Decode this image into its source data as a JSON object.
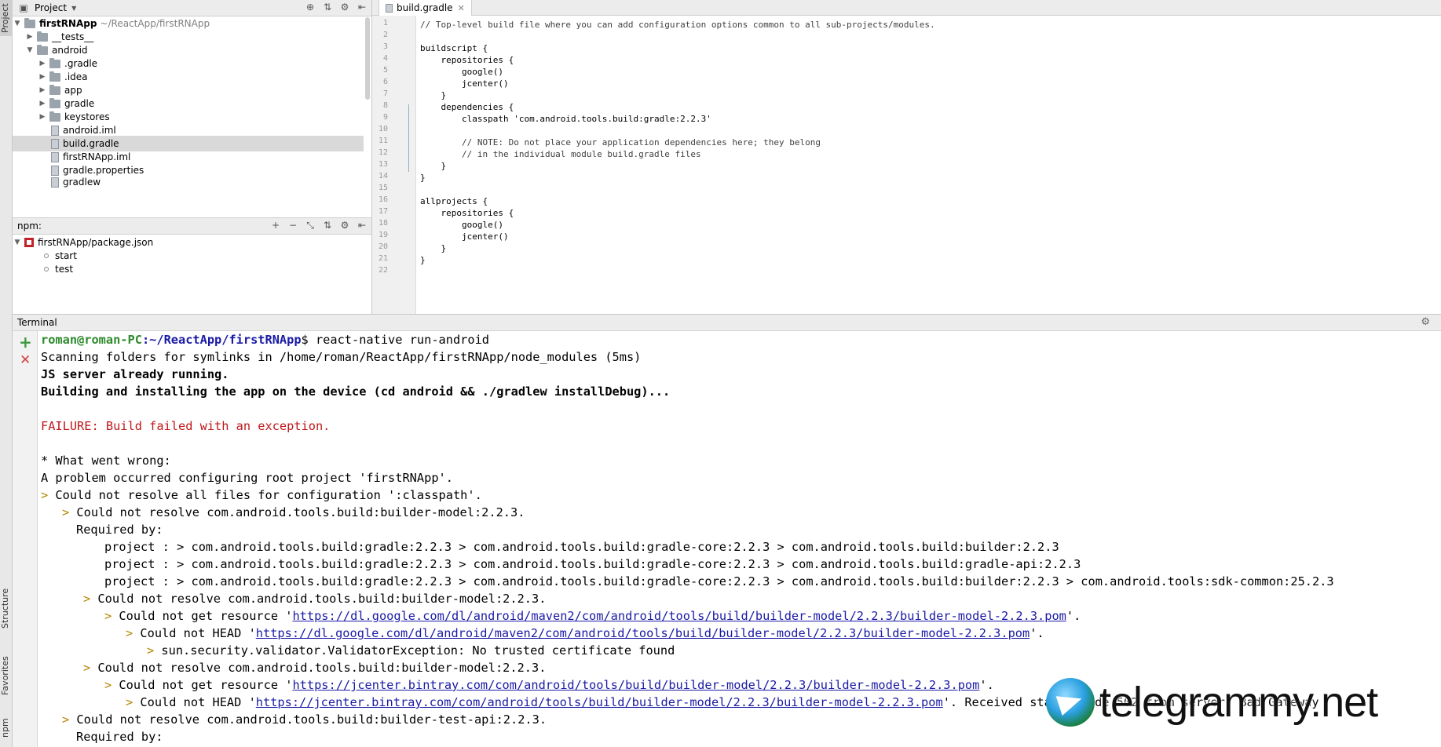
{
  "sidebar": {
    "project_tab": "Project",
    "structure_tab": "Structure",
    "favorites_tab": "Favorites",
    "npm_tab": "npm"
  },
  "project_panel": {
    "title": "Project",
    "tree": [
      {
        "label": "firstRNApp",
        "path": "~/ReactApp/firstRNApp",
        "expanded": true,
        "type": "folder"
      },
      {
        "label": "__tests__",
        "type": "folder"
      },
      {
        "label": "android",
        "type": "folder",
        "expanded": true
      },
      {
        "label": ".gradle",
        "type": "folder"
      },
      {
        "label": ".idea",
        "type": "folder"
      },
      {
        "label": "app",
        "type": "folder"
      },
      {
        "label": "gradle",
        "type": "folder"
      },
      {
        "label": "keystores",
        "type": "folder"
      },
      {
        "label": "android.iml",
        "type": "file"
      },
      {
        "label": "build.gradle",
        "type": "file",
        "selected": true
      },
      {
        "label": "firstRNApp.iml",
        "type": "file"
      },
      {
        "label": "gradle.properties",
        "type": "file"
      },
      {
        "label": "gradlew",
        "type": "file"
      }
    ]
  },
  "npm_panel": {
    "title": "npm:",
    "package": "firstRNApp/package.json",
    "scripts": [
      "start",
      "test"
    ]
  },
  "editor": {
    "tab_label": "build.gradle",
    "lines": [
      "// Top-level build file where you can add configuration options common to all sub-projects/modules.",
      "",
      "buildscript {",
      "    repositories {",
      "        google()",
      "        jcenter()",
      "    }",
      "    dependencies {",
      "        classpath 'com.android.tools.build:gradle:2.2.3'",
      "",
      "        // NOTE: Do not place your application dependencies here; they belong",
      "        // in the individual module build.gradle files",
      "    }",
      "}",
      "",
      "allprojects {",
      "    repositories {",
      "        google()",
      "        jcenter()",
      "    }",
      "}",
      ""
    ]
  },
  "terminal": {
    "title": "Terminal",
    "prompt_user": "roman@roman-PC",
    "prompt_path": ":~/ReactApp/firstRNApp",
    "command": "$ react-native run-android",
    "lines": [
      "Scanning folders for symlinks in /home/roman/ReactApp/firstRNApp/node_modules (5ms)",
      "JS server already running.",
      "Building and installing the app on the device (cd android && ./gradlew installDebug)...",
      "FAILURE: Build failed with an exception.",
      "* What went wrong:",
      "A problem occurred configuring root project 'firstRNApp'.",
      "Could not resolve all files for configuration ':classpath'.",
      "Could not resolve com.android.tools.build:builder-model:2.2.3.",
      "Required by:",
      "project : > com.android.tools.build:gradle:2.2.3 > com.android.tools.build:gradle-core:2.2.3 > com.android.tools.build:builder:2.2.3",
      "project : > com.android.tools.build:gradle:2.2.3 > com.android.tools.build:gradle-core:2.2.3 > com.android.tools.build:gradle-api:2.2.3",
      "project : > com.android.tools.build:gradle:2.2.3 > com.android.tools.build:gradle-core:2.2.3 > com.android.tools.build:builder:2.2.3 > com.android.tools:sdk-common:25.2.3",
      "Could not resolve com.android.tools.build:builder-model:2.2.3.",
      "Could not get resource '",
      "https://dl.google.com/dl/android/maven2/com/android/tools/build/builder-model/2.2.3/builder-model-2.2.3.pom",
      "'.",
      "Could not HEAD '",
      "https://dl.google.com/dl/android/maven2/com/android/tools/build/builder-model/2.2.3/builder-model-2.2.3.pom",
      "'.",
      "sun.security.validator.ValidatorException: No trusted certificate found",
      "Could not resolve com.android.tools.build:builder-model:2.2.3.",
      "Could not get resource '",
      "https://jcenter.bintray.com/com/android/tools/build/builder-model/2.2.3/builder-model-2.2.3.pom",
      "'.",
      "Could not HEAD '",
      "https://jcenter.bintray.com/com/android/tools/build/builder-model/2.2.3/builder-model-2.2.3.pom",
      "'. Received status code 502 from server: Bad Gateway",
      "Could not resolve com.android.tools.build:builder-test-api:2.2.3.",
      "Required by:"
    ]
  },
  "watermark": {
    "text": "telegrammy.net"
  },
  "colors": {
    "prompt_user": "#2e8b2e",
    "prompt_path": "#1a1aa6",
    "failure": "#c0171a",
    "link": "#1a1aa6"
  }
}
